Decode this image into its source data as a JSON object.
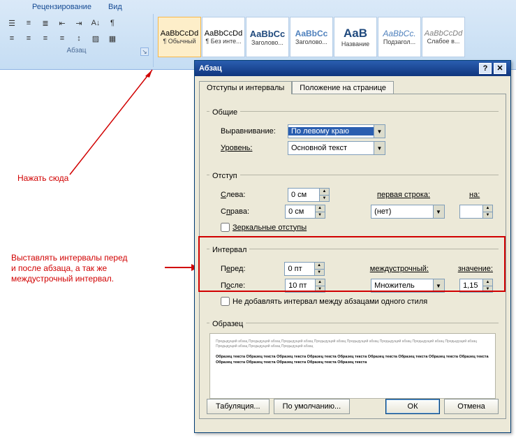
{
  "ribbon": {
    "tabs": {
      "t1": "Рецензирование",
      "t2": "Вид"
    },
    "group_paragraph": "Абзац",
    "styles": [
      {
        "preview": "AaBbCcDd",
        "label": "¶ Обычный",
        "color": "#000",
        "italic": false,
        "bold": false,
        "size": 11
      },
      {
        "preview": "AaBbCcDd",
        "label": "¶ Без инте...",
        "color": "#000",
        "italic": false,
        "bold": false,
        "size": 11
      },
      {
        "preview": "AaBbCc",
        "label": "Заголово...",
        "color": "#1f497d",
        "italic": false,
        "bold": true,
        "size": 13
      },
      {
        "preview": "AaBbCc",
        "label": "Заголово...",
        "color": "#4f81bd",
        "italic": false,
        "bold": true,
        "size": 12
      },
      {
        "preview": "AaB",
        "label": "Название",
        "color": "#1f497d",
        "italic": false,
        "bold": true,
        "size": 17
      },
      {
        "preview": "AaBbCc.",
        "label": "Подзагол...",
        "color": "#4f81bd",
        "italic": true,
        "bold": false,
        "size": 12
      },
      {
        "preview": "AaBbCcDd",
        "label": "Слабое в...",
        "color": "#7f7f7f",
        "italic": true,
        "bold": false,
        "size": 11
      }
    ]
  },
  "annotations": {
    "click_here": "Нажать сюда",
    "interval_note": "Выставлять интервалы перед\nи после абзаца, а так же\nмеждустрочный интервал."
  },
  "dialog": {
    "title": "Абзац",
    "tab1": "Отступы и интервалы",
    "tab2": "Положение на странице",
    "general": {
      "legend": "Общие",
      "align_label": "Выравнивание:",
      "align_value": "По левому краю",
      "level_label": "Уровень:",
      "level_value": "Основной текст"
    },
    "indent": {
      "legend": "Отступ",
      "left_label": "Слева:",
      "left_value": "0 см",
      "right_label": "Справа:",
      "right_value": "0 см",
      "firstline_label": "первая строка:",
      "firstline_value": "(нет)",
      "on_label": "на:",
      "on_value": "",
      "mirror": "Зеркальные отступы"
    },
    "spacing": {
      "legend": "Интервал",
      "before_label": "Перед:",
      "before_value": "0 пт",
      "after_label": "После:",
      "after_value": "10 пт",
      "line_label": "междустрочный:",
      "line_value": "Множитель",
      "at_label": "значение:",
      "at_value": "1,15",
      "nosame": "Не добавлять интервал между абзацами одного стиля"
    },
    "preview_legend": "Образец",
    "buttons": {
      "tabs": "Табуляция...",
      "default": "По умолчанию...",
      "ok": "ОК",
      "cancel": "Отмена"
    }
  }
}
